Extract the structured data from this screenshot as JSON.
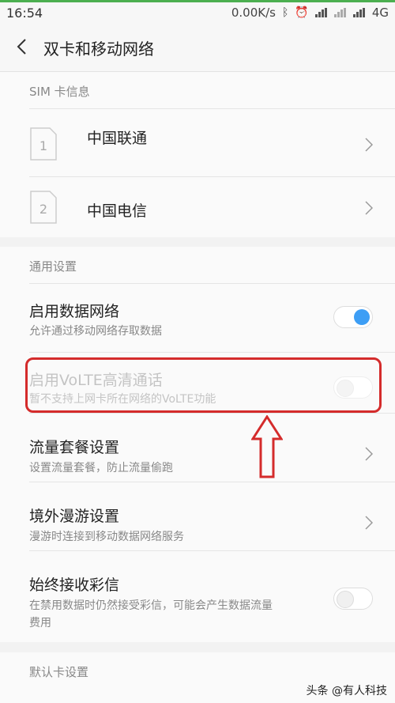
{
  "status_bar": {
    "time": "16:54",
    "network_speed": "0.00K/s",
    "icons": [
      "bluetooth-icon",
      "alarm-icon",
      "signal-icon",
      "signal-icon",
      "signal-icon"
    ],
    "network_type": "4G"
  },
  "header": {
    "title": "双卡和移动网络"
  },
  "sim_section": {
    "label": "SIM 卡信息",
    "cards": [
      {
        "slot": "1",
        "name": "中国联通"
      },
      {
        "slot": "2",
        "name": "中国电信"
      }
    ]
  },
  "general_section": {
    "label": "通用设置",
    "rows": [
      {
        "title": "启用数据网络",
        "subtitle": "允许通过移动网络存取数据",
        "control": "toggle",
        "on": true
      },
      {
        "title": "启用VoLTE高清通话",
        "subtitle": "暂不支持上网卡所在网络的VoLTE功能",
        "control": "toggle",
        "on": false,
        "disabled": true
      },
      {
        "title": "流量套餐设置",
        "subtitle": "设置流量套餐，防止流量偷跑",
        "control": "chevron"
      },
      {
        "title": "境外漫游设置",
        "subtitle": "漫游时连接到移动数据网络服务",
        "control": "chevron"
      },
      {
        "title": "始终接收彩信",
        "subtitle": "在禁用数据时仍然接受彩信，可能会产生数据流量",
        "subtitle2": "费用",
        "control": "toggle",
        "on": false
      }
    ]
  },
  "default_section": {
    "label": "默认卡设置"
  },
  "watermark": "头条 @有人科技",
  "colors": {
    "accent": "#3d9ef5",
    "annotation": "#d42b2b"
  }
}
